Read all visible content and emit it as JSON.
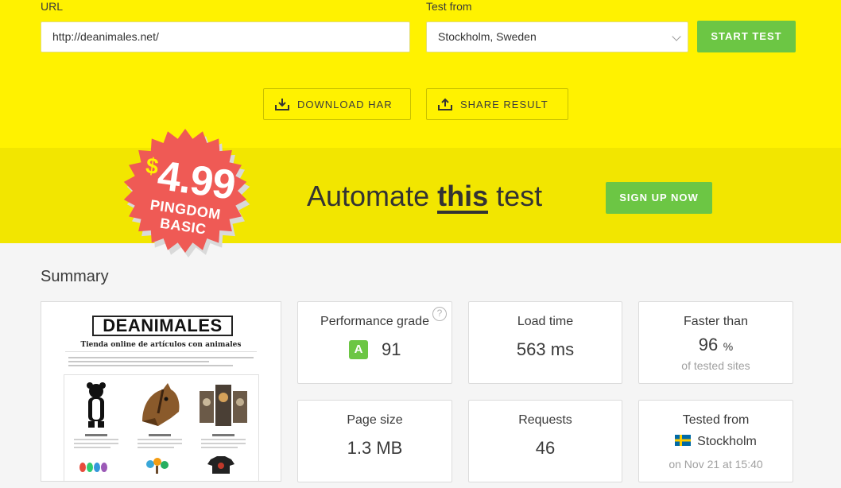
{
  "form": {
    "url_label": "URL",
    "url_value": "http://deanimales.net/",
    "test_from_label": "Test from",
    "test_from_value": "Stockholm, Sweden",
    "start_button": "START TEST"
  },
  "actions": {
    "download_har": "DOWNLOAD HAR",
    "share_result": "SHARE RESULT"
  },
  "promo": {
    "price_symbol": "$",
    "price": "4.99",
    "plan_line1": "PINGDOM",
    "plan_line2": "BASIC",
    "text_before": "Automate ",
    "text_emphasis": "this",
    "text_after": " test",
    "signup_button": "SIGN UP NOW"
  },
  "summary": {
    "title": "Summary",
    "screenshot": {
      "logo": "DEANIMALES",
      "tagline": "Tienda online de artículos con animales"
    },
    "performance_grade": {
      "title": "Performance grade",
      "letter": "A",
      "score": "91",
      "help": "?"
    },
    "load_time": {
      "title": "Load time",
      "value": "563 ms"
    },
    "faster_than": {
      "title": "Faster than",
      "value": "96",
      "unit": "%",
      "sub": "of tested sites"
    },
    "page_size": {
      "title": "Page size",
      "value": "1.3 MB"
    },
    "requests": {
      "title": "Requests",
      "value": "46"
    },
    "tested_from": {
      "title": "Tested from",
      "location": "Stockholm",
      "date": "on Nov 21 at 15:40"
    }
  },
  "colors": {
    "yellow": "#fff200",
    "promo_yellow": "#f2e600",
    "green": "#6cc644",
    "badge_red": "#ef5a55",
    "grade_green": "#6cc644"
  }
}
